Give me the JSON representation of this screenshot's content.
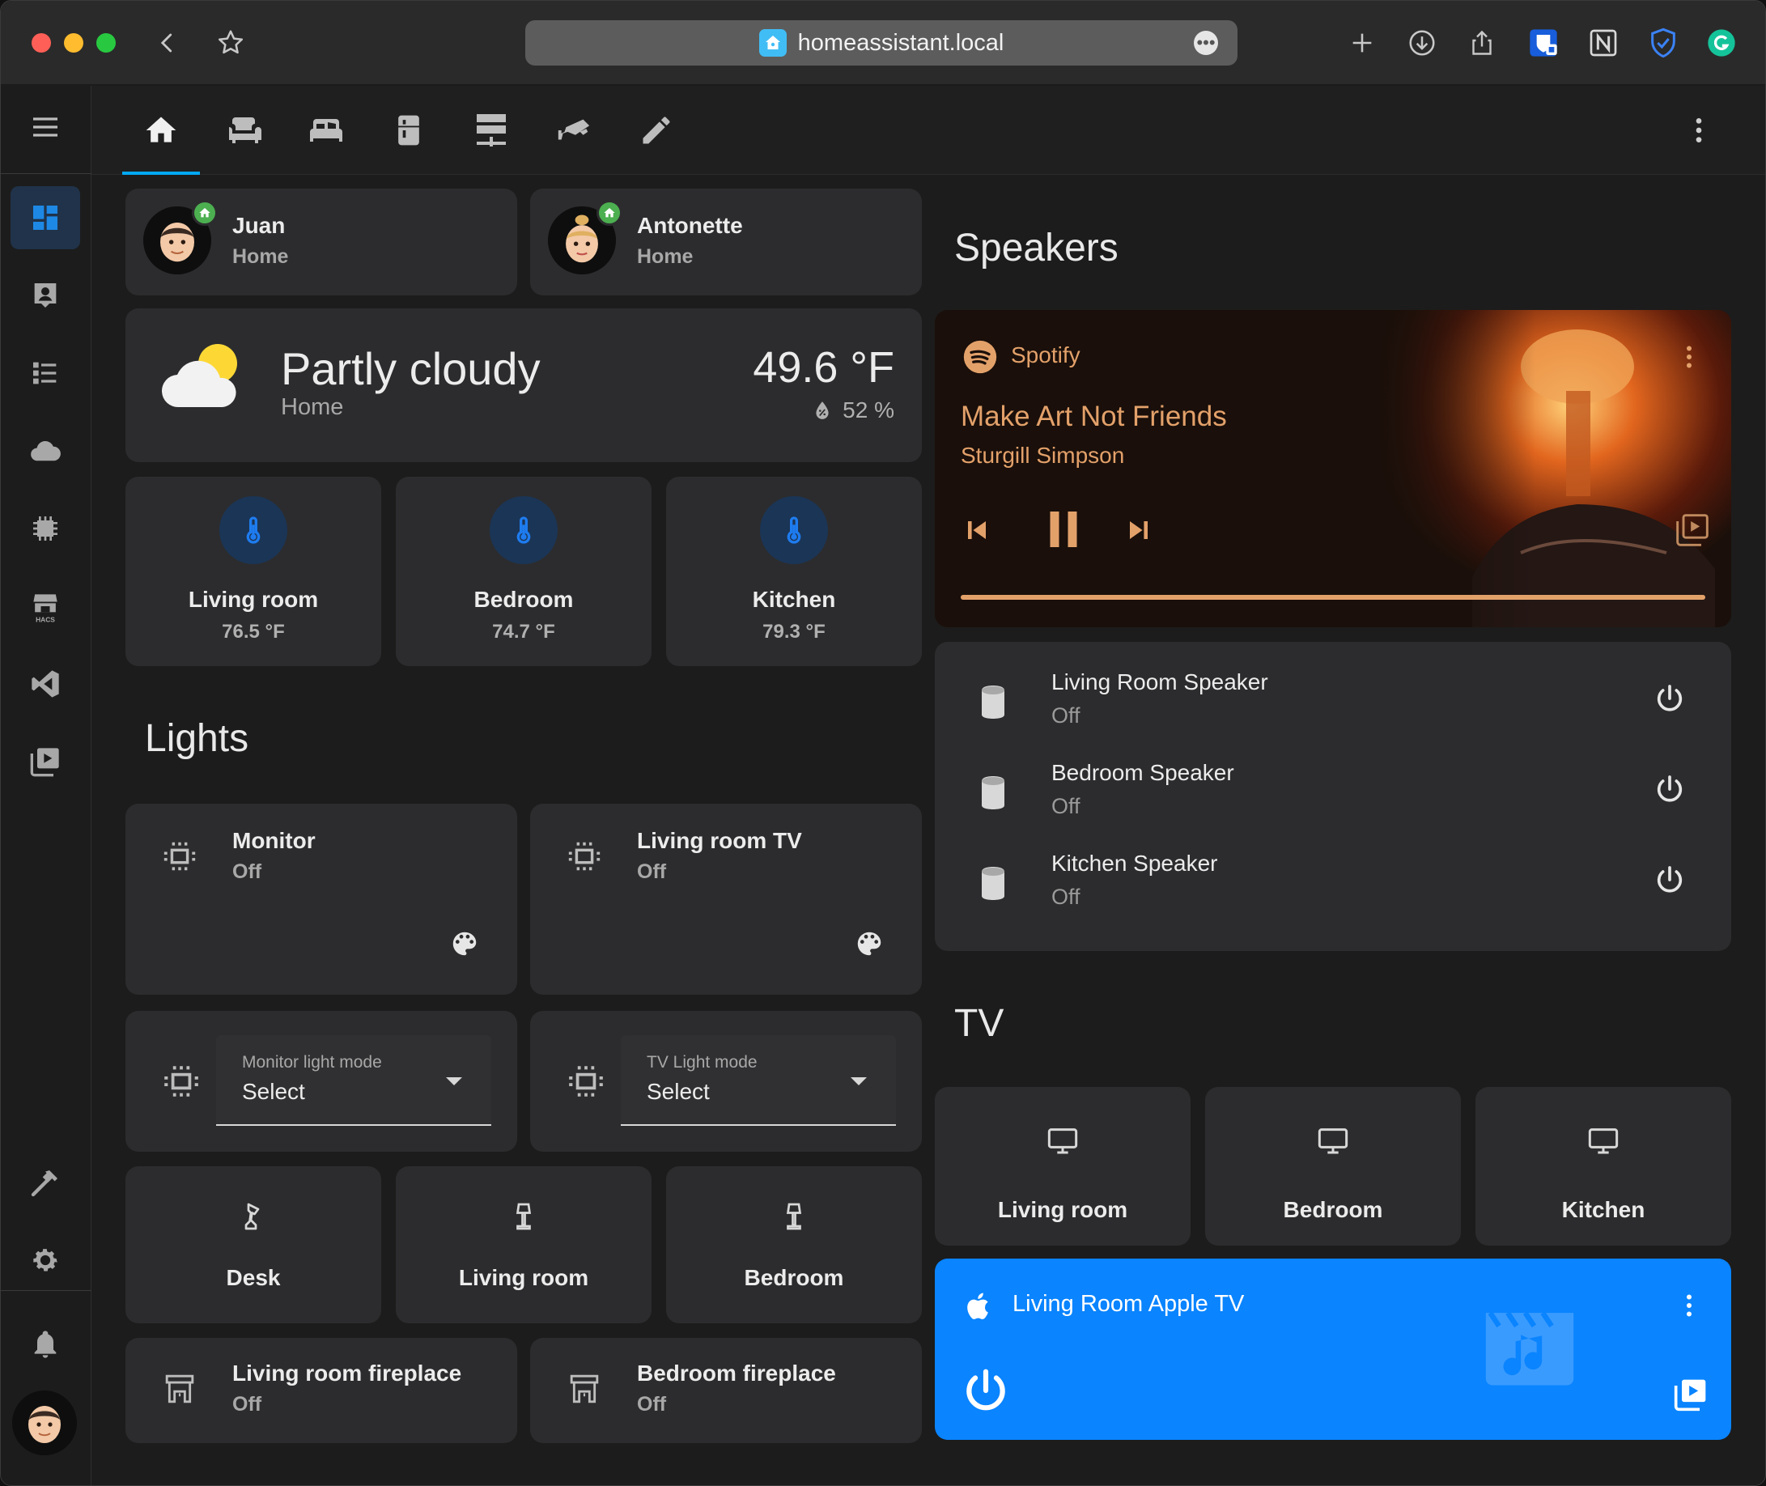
{
  "browser": {
    "url": "homeassistant.local"
  },
  "people": [
    {
      "name": "Juan",
      "state": "Home"
    },
    {
      "name": "Antonette",
      "state": "Home"
    }
  ],
  "weather": {
    "condition": "Partly cloudy",
    "location": "Home",
    "temperature": "49.6 °F",
    "humidity": "52 %"
  },
  "thermostats": [
    {
      "name": "Living room",
      "value": "76.5 °F"
    },
    {
      "name": "Bedroom",
      "value": "74.7 °F"
    },
    {
      "name": "Kitchen",
      "value": "79.3 °F"
    }
  ],
  "lights": {
    "title": "Lights",
    "tiles": [
      {
        "name": "Monitor",
        "state": "Off"
      },
      {
        "name": "Living room TV",
        "state": "Off"
      }
    ],
    "selects": [
      {
        "label": "Monitor light mode",
        "value": "Select"
      },
      {
        "label": "TV Light mode",
        "value": "Select"
      }
    ],
    "buttons": [
      {
        "name": "Desk"
      },
      {
        "name": "Living room"
      },
      {
        "name": "Bedroom"
      }
    ],
    "fireplaces": [
      {
        "name": "Living room fireplace",
        "state": "Off"
      },
      {
        "name": "Bedroom fireplace",
        "state": "Off"
      }
    ]
  },
  "speakers": {
    "title": "Speakers",
    "player": {
      "source": "Spotify",
      "track": "Make Art Not Friends",
      "artist": "Sturgill Simpson",
      "progress": 1.0,
      "accent_color": "#e3a16a"
    },
    "rows": [
      {
        "name": "Living Room Speaker",
        "state": "Off"
      },
      {
        "name": "Bedroom Speaker",
        "state": "Off"
      },
      {
        "name": "Kitchen Speaker",
        "state": "Off"
      }
    ]
  },
  "tv": {
    "title": "TV",
    "tiles": [
      {
        "name": "Living room"
      },
      {
        "name": "Bedroom"
      },
      {
        "name": "Kitchen"
      }
    ],
    "apple_tv": {
      "name": "Living Room Apple TV",
      "color": "#0a84ff"
    }
  },
  "colors": {
    "primary": "#03a9f4",
    "thermo_icon": "#1e7cf0",
    "thermo_circle": "#1b3556",
    "home_badge": "#4caf50"
  }
}
